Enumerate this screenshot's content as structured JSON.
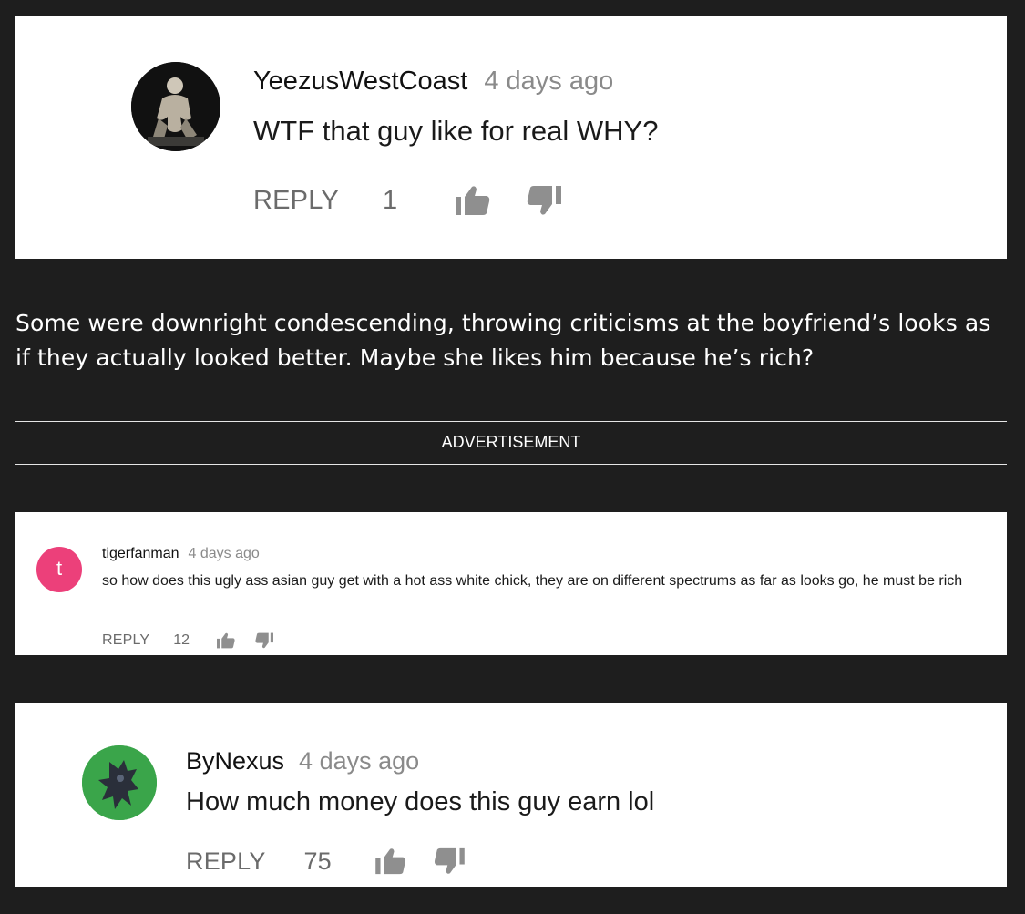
{
  "comments": [
    {
      "author": "YeezusWestCoast",
      "time": "4 days ago",
      "text": "WTF that guy like for real WHY?",
      "reply_label": "REPLY",
      "likes": "1",
      "avatar_icon": "person-photo-avatar"
    },
    {
      "author": "tigerfanman",
      "time": "4 days ago",
      "text": "so how does this ugly ass asian guy get with a hot ass white chick, they are on different spectrums as far as looks go, he must be rich",
      "reply_label": "REPLY",
      "likes": "12",
      "avatar_letter": "t",
      "avatar_color": "#ec407a"
    },
    {
      "author": "ByNexus",
      "time": "4 days ago",
      "text": "How much money does this guy earn lol",
      "reply_label": "REPLY",
      "likes": "75",
      "avatar_icon": "character-avatar",
      "avatar_color": "#3aa54a"
    }
  ],
  "article": {
    "paragraph": "Some were downright condescending, throwing criticisms at the boyfriend’s looks as if they actually looked better. Maybe she likes him because he’s rich?"
  },
  "advertisement_label": "ADVERTISEMENT",
  "icons": {
    "like": "thumbs-up-icon",
    "dislike": "thumbs-down-icon"
  }
}
